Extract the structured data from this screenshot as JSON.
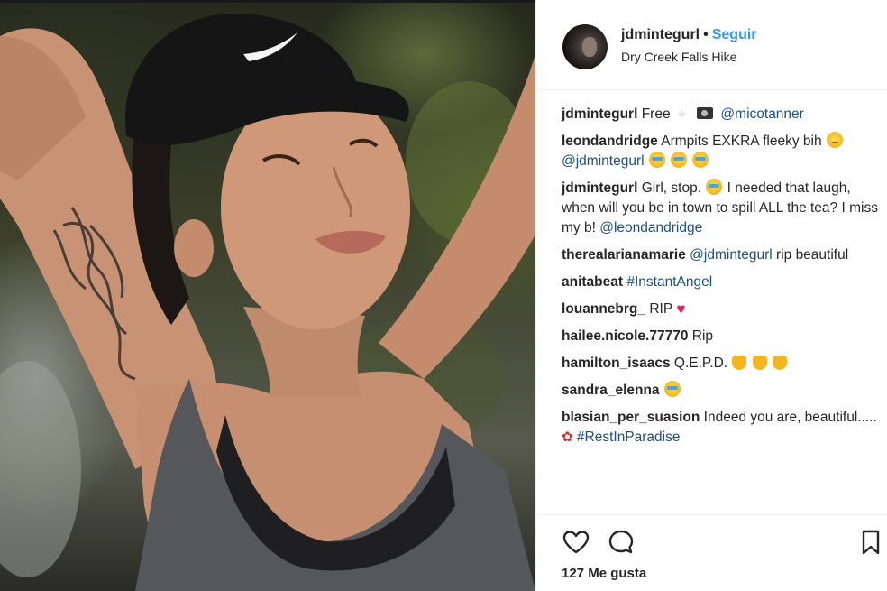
{
  "post": {
    "username": "jdmintegurl",
    "separator": "•",
    "follow_label": "Seguir",
    "location": "Dry Creek Falls Hike"
  },
  "comments": [
    {
      "user": "jdmintegurl",
      "parts": [
        {
          "t": "text",
          "v": "Free"
        },
        {
          "t": "emoji",
          "v": "dove-icon"
        },
        {
          "t": "emoji",
          "v": "camera-icon"
        },
        {
          "t": "link",
          "v": "@micotanner"
        }
      ]
    },
    {
      "user": "leondandridge",
      "parts": [
        {
          "t": "text",
          "v": "Armpits EXKRA fleeky bih"
        },
        {
          "t": "emoji",
          "v": "disappointed-face-icon"
        },
        {
          "t": "link",
          "v": "@jdmintegurl"
        },
        {
          "t": "emoji",
          "v": "tears-of-joy-icon"
        },
        {
          "t": "emoji",
          "v": "crying-face-icon"
        },
        {
          "t": "emoji",
          "v": "rolling-laughing-icon"
        }
      ]
    },
    {
      "user": "jdmintegurl",
      "parts": [
        {
          "t": "text",
          "v": "Girl, stop."
        },
        {
          "t": "emoji",
          "v": "tears-of-joy-icon"
        },
        {
          "t": "text",
          "v": "I needed that laugh, when will you be in town to spill ALL the tea? I miss my b!"
        },
        {
          "t": "link",
          "v": "@leondandridge"
        }
      ]
    },
    {
      "user": "therealarianamarie",
      "parts": [
        {
          "t": "link",
          "v": "@jdmintegurl"
        },
        {
          "t": "text",
          "v": "rip beautiful"
        }
      ]
    },
    {
      "user": "anitabeat",
      "parts": [
        {
          "t": "link",
          "v": "#InstantAngel"
        }
      ]
    },
    {
      "user": "louannebrg_",
      "parts": [
        {
          "t": "text",
          "v": "RIP"
        },
        {
          "t": "emoji",
          "v": "red-heart-icon"
        }
      ]
    },
    {
      "user": "hailee.nicole.77770",
      "parts": [
        {
          "t": "text",
          "v": "Rip"
        }
      ]
    },
    {
      "user": "hamilton_isaacs",
      "parts": [
        {
          "t": "text",
          "v": "Q.E.P.D."
        },
        {
          "t": "emoji",
          "v": "praying-hands-icon"
        },
        {
          "t": "emoji",
          "v": "praying-hands-icon"
        },
        {
          "t": "emoji",
          "v": "praying-hands-icon"
        }
      ]
    },
    {
      "user": "sandra_elenna",
      "parts": [
        {
          "t": "emoji",
          "v": "crying-face-icon"
        }
      ]
    },
    {
      "user": "blasian_per_suasion",
      "parts": [
        {
          "t": "text",
          "v": "Indeed you are, beautiful....."
        },
        {
          "t": "emoji",
          "v": "rose-icon"
        },
        {
          "t": "link",
          "v": "#RestInParadise"
        }
      ]
    }
  ],
  "actions": {
    "like_icon": "heart-outline-icon",
    "comment_icon": "comment-bubble-icon",
    "save_icon": "bookmark-icon",
    "likes_label": "127 Me gusta"
  },
  "colors": {
    "link": "#1e4f80",
    "follow": "#3897f0",
    "text": "#262626",
    "divider": "#efefef"
  }
}
